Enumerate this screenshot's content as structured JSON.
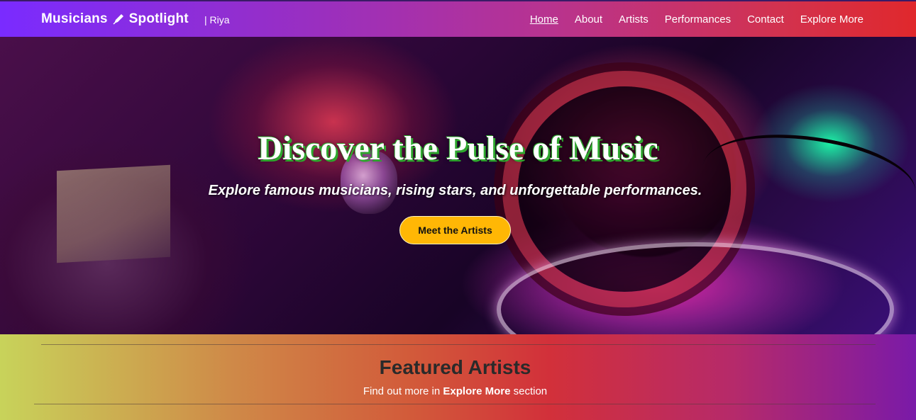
{
  "nav": {
    "brand": "Musicians",
    "brand_suffix": "Spotlight",
    "brand_icon": "pen-icon",
    "byline": "| Riya",
    "links": [
      {
        "label": "Home",
        "active": true
      },
      {
        "label": "About",
        "active": false
      },
      {
        "label": "Artists",
        "active": false
      },
      {
        "label": "Performances",
        "active": false
      },
      {
        "label": "Contact",
        "active": false
      },
      {
        "label": "Explore More",
        "active": false
      }
    ]
  },
  "hero": {
    "title": "Discover the Pulse of Music",
    "subtitle": "Explore famous musicians, rising stars, and unforgettable performances.",
    "cta_label": "Meet the Artists"
  },
  "featured": {
    "title": "Featured Artists",
    "sub_prefix": "Find out more in ",
    "sub_bold": "Explore More",
    "sub_suffix": " section"
  },
  "colors": {
    "cta": "#ffb705",
    "title_shadow": "#2ea82e",
    "nav_start": "#7a2bff",
    "nav_end": "#e0282c"
  }
}
